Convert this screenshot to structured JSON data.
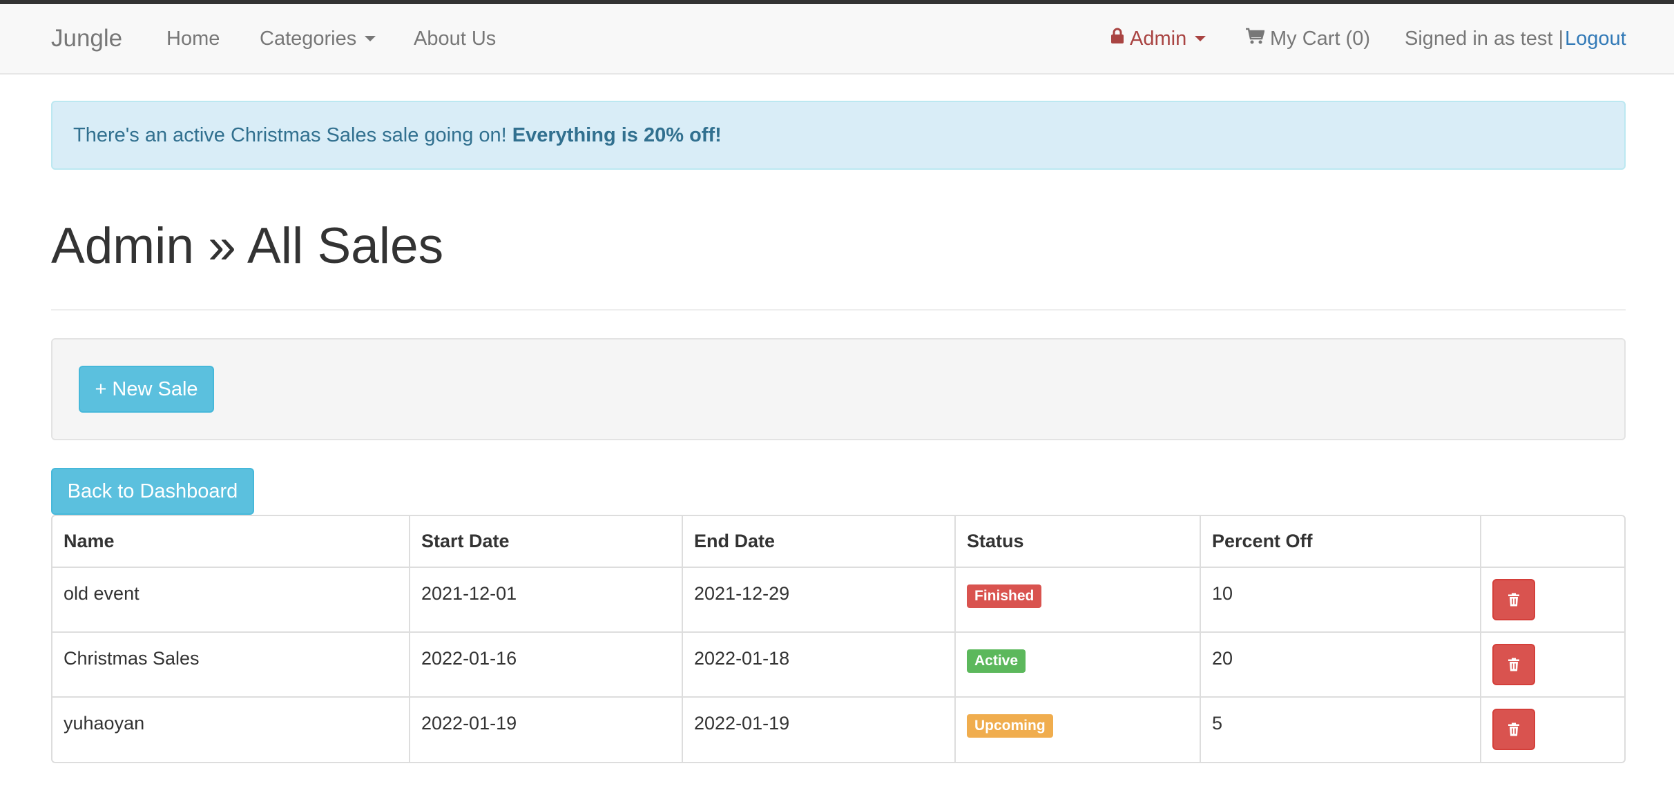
{
  "navbar": {
    "brand": "Jungle",
    "home": "Home",
    "categories": "Categories",
    "about": "About Us",
    "admin": "Admin",
    "cart": "My Cart (0)",
    "signed_in": "Signed in as test |",
    "logout": "Logout",
    "icons": {
      "admin": "lock-icon",
      "cart": "shopping-cart-icon"
    }
  },
  "alert": {
    "text": "There's an active Christmas Sales sale going on! ",
    "emphasis": "Everything is 20% off!"
  },
  "page": {
    "title": "Admin » All Sales"
  },
  "actions": {
    "new_sale": "+ New Sale",
    "back": "Back to Dashboard"
  },
  "table": {
    "headers": [
      "Name",
      "Start Date",
      "End Date",
      "Status",
      "Percent Off",
      ""
    ],
    "rows": [
      {
        "name": "old event",
        "start": "2021-12-01",
        "end": "2021-12-29",
        "status": "Finished",
        "status_color": "#d9534f",
        "percent": "10"
      },
      {
        "name": "Christmas Sales",
        "start": "2022-01-16",
        "end": "2022-01-18",
        "status": "Active",
        "status_color": "#5cb85c",
        "percent": "20"
      },
      {
        "name": "yuhaoyan",
        "start": "2022-01-19",
        "end": "2022-01-19",
        "status": "Upcoming",
        "status_color": "#f0ad4e",
        "percent": "5"
      }
    ],
    "delete_icon": "trash-icon"
  },
  "colors": {
    "info": "#5bc0de",
    "danger": "#d9534f",
    "link": "#337ab7",
    "admin": "#a94442",
    "alert_bg": "#d9edf7"
  }
}
